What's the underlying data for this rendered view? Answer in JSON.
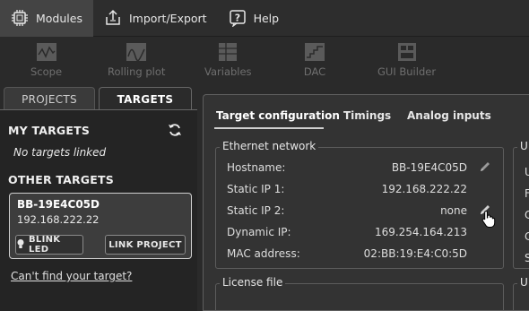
{
  "menubar": {
    "modules_label": "Modules",
    "import_export_label": "Import/Export",
    "help_label": "Help"
  },
  "toolbar": {
    "scope_label": "Scope",
    "rolling_plot_label": "Rolling plot",
    "variables_label": "Variables",
    "dac_label": "DAC",
    "gui_builder_label": "GUI Builder"
  },
  "left_tabs": {
    "projects_label": "PROJECTS",
    "targets_label": "TARGETS"
  },
  "left_panel": {
    "my_targets_title": "MY TARGETS",
    "no_targets_text": "No targets linked",
    "other_targets_title": "OTHER TARGETS",
    "target": {
      "name": "BB-19E4C05D",
      "ip": "192.168.222.22",
      "blink_label": "BLINK LED",
      "link_label": "LINK PROJECT"
    },
    "cant_find_link": "Can't find your target?"
  },
  "main": {
    "tabs": [
      "Target configuration",
      "Timings",
      "Analog inputs"
    ],
    "ethernet_group_title": "Ethernet network",
    "license_group_title": "License file",
    "rows": [
      {
        "label": "Hostname:",
        "value": "BB-19E4C05D"
      },
      {
        "label": "Static IP 1:",
        "value": "192.168.222.22"
      },
      {
        "label": "Static IP 2:",
        "value": "none"
      },
      {
        "label": "Dynamic IP:",
        "value": "169.254.164.213"
      },
      {
        "label": "MAC address:",
        "value": "02:BB:19:E4:C0:5D"
      }
    ],
    "right_group_title_partial": "U",
    "right_group2_title_partial": "U",
    "right_letters": [
      "U",
      "F",
      "C",
      "C",
      "S"
    ]
  },
  "icons": {
    "modules": "chip-icon",
    "import_export": "export-icon",
    "help": "help-icon",
    "refresh": "refresh-icon",
    "edit": "pencil-icon",
    "cursor": "hand-cursor-icon"
  }
}
